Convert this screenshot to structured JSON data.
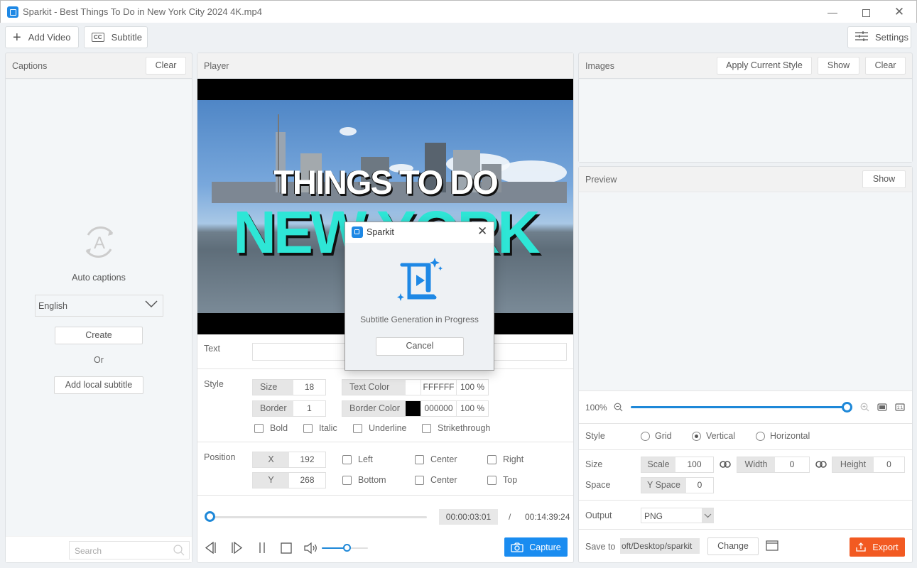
{
  "window": {
    "title": "Sparkit - Best Things To Do in New York City 2024 4K.mp4",
    "minimize_icon": "minimize-icon",
    "maximize_icon": "maximize-icon",
    "close_icon": "close-icon"
  },
  "toolbar": {
    "add_video": "Add Video",
    "subtitle": "Subtitle",
    "settings": "Settings"
  },
  "captions": {
    "title": "Captions",
    "clear": "Clear",
    "auto_captions": "Auto captions",
    "language": "English",
    "create": "Create",
    "or": "Or",
    "add_local": "Add local subtitle",
    "search_placeholder": "Search"
  },
  "player": {
    "title": "Player",
    "video_text_line1": "THINGS TO DO",
    "video_text_line2": "NEW YORK",
    "text_label": "Text",
    "text_value": "",
    "style_label": "Style",
    "size_label": "Size",
    "size_value": "18",
    "border_label": "Border",
    "border_value": "1",
    "text_color_label": "Text Color",
    "text_color_hex": "FFFFFF",
    "text_color_opacity": "100 %",
    "text_color_swatch": "#ffffff",
    "border_color_label": "Border Color",
    "border_color_hex": "000000",
    "border_color_opacity": "100 %",
    "border_color_swatch": "#000000",
    "checks": [
      "Bold",
      "Italic",
      "Underline",
      "Strikethrough"
    ],
    "position_label": "Position",
    "x_label": "X",
    "x_value": "192",
    "y_label": "Y",
    "y_value": "268",
    "align_row1": [
      "Left",
      "Center",
      "Right"
    ],
    "align_row2": [
      "Bottom",
      "Center",
      "Top"
    ],
    "current_time": "00:00:03:01",
    "separator": "/",
    "total_time": "00:14:39:24",
    "progress_fraction": 0.0,
    "volume_fraction": 0.55,
    "capture": "Capture"
  },
  "images": {
    "title": "Images",
    "apply_style": "Apply Current Style",
    "show": "Show",
    "clear": "Clear"
  },
  "preview": {
    "title": "Preview",
    "show": "Show",
    "zoom_label": "100%",
    "zoom_fraction": 1.0,
    "style_label": "Style",
    "style_options": [
      "Grid",
      "Vertical",
      "Horizontal"
    ],
    "style_selected": "Vertical",
    "size_label": "Size",
    "scale_label": "Scale",
    "scale_value": "100",
    "width_label": "Width",
    "width_value": "0",
    "height_label": "Height",
    "height_value": "0",
    "space_label": "Space",
    "yspace_label": "Y Space",
    "yspace_value": "0",
    "output_label": "Output",
    "output_value": "PNG",
    "save_label": "Save to",
    "save_path": "oft/Desktop/sparkit",
    "change": "Change",
    "export": "Export"
  },
  "dialog": {
    "title": "Sparkit",
    "message": "Subtitle Generation in Progress",
    "cancel": "Cancel"
  },
  "colors": {
    "accent": "#1a8cf0",
    "export": "#f25a22",
    "title_teal": "#2ee6d6"
  }
}
